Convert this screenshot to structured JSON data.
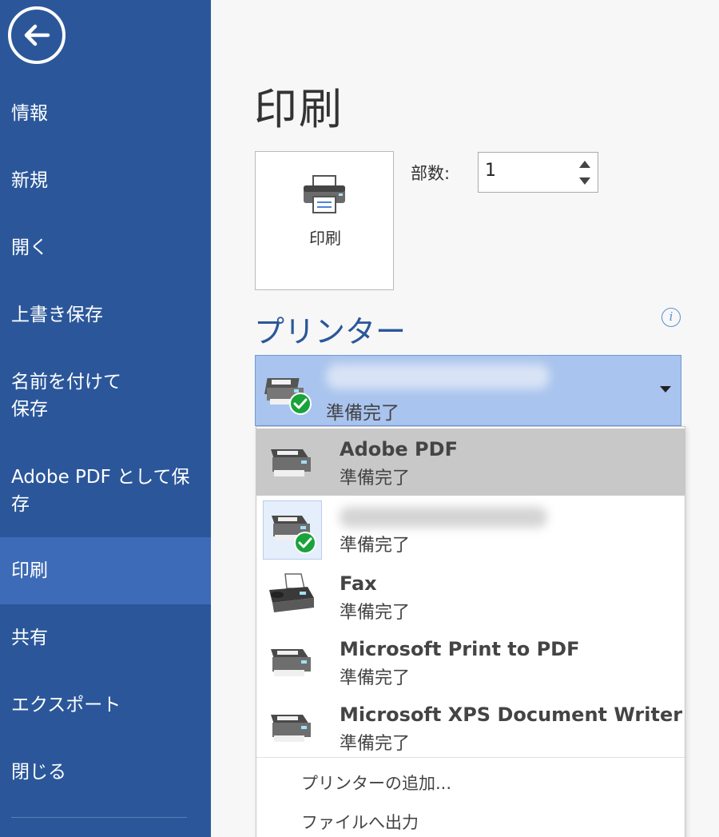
{
  "sidebar": {
    "items": [
      {
        "label": "情報"
      },
      {
        "label": "新規"
      },
      {
        "label": "開く"
      },
      {
        "label": "上書き保存"
      },
      {
        "label": "名前を付けて",
        "label2": "保存"
      },
      {
        "label": "Adobe PDF として保",
        "label2": "存"
      },
      {
        "label": "印刷",
        "active": true
      },
      {
        "label": "共有"
      },
      {
        "label": "エクスポート"
      },
      {
        "label": "閉じる"
      }
    ]
  },
  "main": {
    "title": "印刷",
    "print_button_label": "印刷",
    "copies_label": "部数:",
    "copies_value": "1",
    "printer_heading": "プリンター",
    "info_glyph": "i",
    "selected_printer": {
      "status": "準備完了"
    }
  },
  "printer_list": [
    {
      "name": "Adobe PDF",
      "status": "準備完了",
      "state": "hover"
    },
    {
      "status": "準備完了",
      "state": "selected",
      "default": true
    },
    {
      "name": "Fax",
      "status": "準備完了"
    },
    {
      "name": "Microsoft Print to PDF",
      "status": "準備完了"
    },
    {
      "name": "Microsoft XPS Document Writer",
      "status": "準備完了"
    }
  ],
  "dropdown_actions": {
    "add_printer": "プリンターの追加...",
    "print_to_file": "ファイルへ出力"
  },
  "colors": {
    "sidebar": "#2b579a",
    "sidebar_active": "#3e6bb7",
    "accent": "#2b579a",
    "select_bg": "#a9c4ee",
    "check_green": "#1aa33a"
  }
}
